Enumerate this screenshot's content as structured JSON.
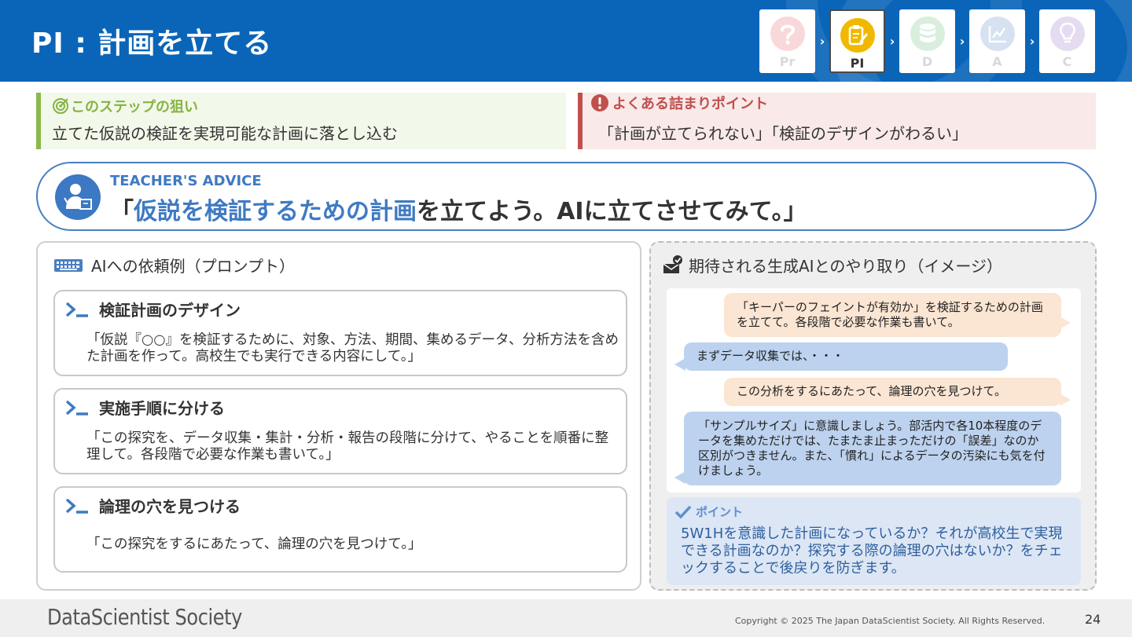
{
  "header": {
    "title": "PI : 計画を立てる",
    "steps": [
      {
        "label": "Pr",
        "icon": "question-icon",
        "color": "#e8525a",
        "active": false
      },
      {
        "label": "PI",
        "icon": "clipboard-pencil-icon",
        "color": "#f1b800",
        "active": true
      },
      {
        "label": "D",
        "icon": "database-icon",
        "color": "#5bb56a",
        "active": false
      },
      {
        "label": "A",
        "icon": "chart-icon",
        "color": "#4a7fc1",
        "active": false
      },
      {
        "label": "C",
        "icon": "lightbulb-icon",
        "color": "#8b66c4",
        "active": false
      }
    ]
  },
  "aim": {
    "heading": "このステップの狙い",
    "text": "立てた仮説の検証を実現可能な計画に落とし込む"
  },
  "pitfall": {
    "heading": "よくある詰まりポイント",
    "text": "「計画が立てられない」「検証のデザインがわるい」"
  },
  "advice": {
    "label": "TEACHER'S ADVICE",
    "open": "「",
    "highlight": "仮説を検証するための計画",
    "rest": "を立てよう。AIに立てさせてみて。」"
  },
  "prompt_panel": {
    "heading": "AIへの依頼例（プロンプト）",
    "cards": [
      {
        "title": "検証計画のデザイン",
        "body": "「仮説『○○』を検証するために、対象、方法、期間、集めるデータ、分析方法を含めた計画を作って。高校生でも実行できる内容にして。」"
      },
      {
        "title": "実施手順に分ける",
        "body": "「この探究を、データ収集・集計・分析・報告の段階に分けて、やることを順番に整理して。各段階で必要な作業も書いて。」"
      },
      {
        "title": "論理の穴を見つける",
        "body": "「この探究をするにあたって、論理の穴を見つけて。」"
      }
    ]
  },
  "chat_panel": {
    "heading": "期待される生成AIとのやり取り（イメージ）",
    "messages": [
      {
        "role": "user",
        "text": "「キーパーのフェイントが有効か」を検証するための計画を立てて。各段階で必要な作業も書いて。"
      },
      {
        "role": "ai",
        "text": "まずデータ収集では、・・・"
      },
      {
        "role": "user",
        "text": "この分析をするにあたって、論理の穴を見つけて。"
      },
      {
        "role": "ai",
        "text": "「サンプルサイズ」に意識しましょう。部活内で各10本程度のデータを集めただけでは、たまたま止まっただけの「誤差」なのか区別がつきません。また、「慣れ」によるデータの汚染にも気を付けましょう。"
      }
    ],
    "point_heading": "ポイント",
    "point_text": "5W1Hを意識した計画になっているか？それが高校生で実現できる計画なのか？探究する際の論理の穴はないか？をチェックすることで後戻りを防ぎます。"
  },
  "footer": {
    "brand": "DataScientist Society",
    "copyright": "Copyright © 2025 The Japan DataScientist Society. All Rights Reserved.",
    "page": "24"
  }
}
